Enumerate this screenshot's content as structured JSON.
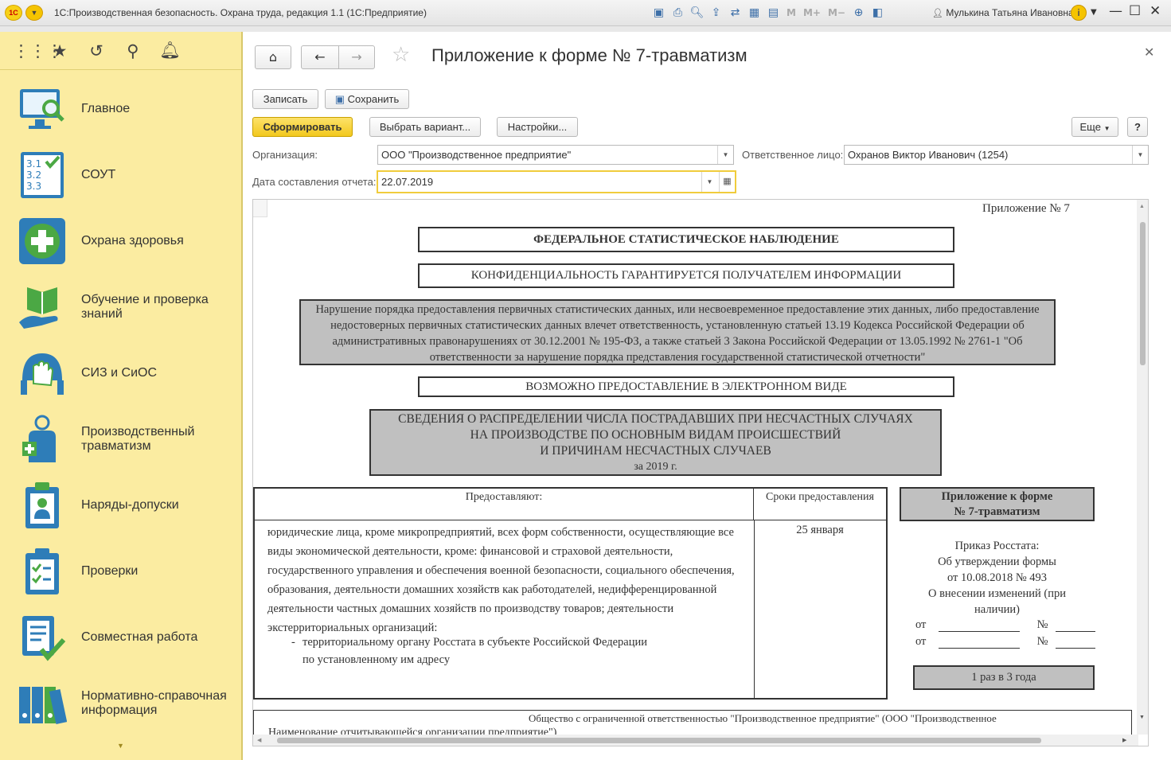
{
  "window": {
    "title": "1С:Производственная безопасность. Охрана труда, редакция 1.1  (1С:Предприятие)",
    "user": "Мулькина Татьяна Ивановна",
    "memory_buttons": [
      "M",
      "M+",
      "M−"
    ]
  },
  "sidebar": {
    "items": [
      {
        "label": "Главное",
        "icon": "monitor-search-icon"
      },
      {
        "label": "СОУТ",
        "icon": "checklist-icon"
      },
      {
        "label": "Охрана здоровья",
        "icon": "medical-cross-icon"
      },
      {
        "label": "Обучение и проверка знаний",
        "icon": "book-hand-icon"
      },
      {
        "label": "СИЗ и СиОС",
        "icon": "helmet-icon"
      },
      {
        "label": "Производственный травматизм",
        "icon": "injured-person-icon"
      },
      {
        "label": "Наряды-допуски",
        "icon": "permit-clipboard-icon"
      },
      {
        "label": "Проверки",
        "icon": "checklist-clipboard-icon"
      },
      {
        "label": "Совместная работа",
        "icon": "document-check-icon"
      },
      {
        "label": "Нормативно-справочная информация",
        "icon": "binders-icon"
      }
    ]
  },
  "form": {
    "title": "Приложение к форме № 7-травматизм",
    "buttons": {
      "write": "Записать",
      "save": "Сохранить",
      "generate": "Сформировать",
      "choose_variant": "Выбрать вариант...",
      "settings": "Настройки...",
      "more": "Еще",
      "help": "?"
    },
    "org_label": "Организация:",
    "org_value": "ООО \"Производственное предприятие\"",
    "responsible_label": "Ответственное лицо:",
    "responsible_value": "Охранов Виктор Иванович (1254)",
    "date_label": "Дата составления отчета:",
    "date_value": "22.07.2019"
  },
  "report": {
    "appendix": "Приложение № 7",
    "federal": "ФЕДЕРАЛЬНОЕ СТАТИСТИЧЕСКОЕ НАБЛЮДЕНИЕ",
    "confidential": "КОНФИДЕНЦИАЛЬНОСТЬ ГАРАНТИРУЕТСЯ ПОЛУЧАТЕЛЕМ ИНФОРМАЦИИ",
    "warning": "Нарушение порядка предоставления первичных статистических данных, или несвоевременное предоставление этих данных, либо предоставление недостоверных первичных статистических данных влечет ответственность, установленную статьей 13.19 Кодекса Российской Федерации об административных правонарушениях от 30.12.2001 № 195-ФЗ, а также статьей 3 Закона Российской Федерации от 13.05.1992 № 2761-1 \"Об ответственности за нарушение порядка представления государственной статистической отчетности\"",
    "electronic": "ВОЗМОЖНО ПРЕДОСТАВЛЕНИЕ В ЭЛЕКТРОННОМ ВИДЕ",
    "info_title_1": "СВЕДЕНИЯ О РАСПРЕДЕЛЕНИИ ЧИСЛА ПОСТРАДАВШИХ ПРИ НЕСЧАСТНЫХ СЛУЧАЯХ",
    "info_title_2": "НА ПРОИЗВОДСТВЕ ПО ОСНОВНЫМ ВИДАМ ПРОИСШЕСТВИЙ",
    "info_title_3": "И ПРИЧИНАМ НЕСЧАСТНЫХ СЛУЧАЕВ",
    "info_year": "за 2019 г.",
    "col_provide": "Предоставляют:",
    "col_deadline": "Сроки предоставления",
    "provide_text": "юридические лица, кроме микропредприятий, всех форм собственности, осуществляющие все виды экономической деятельности, кроме: финансовой и страховой деятельности, государственного управления и обеспечения военной безопасности, социального обеспечения, образования, деятельности домашних хозяйств как работодателей, недифференцированной деятельности частных домашних хозяйств по производству товаров; деятельности экстерриториальных организаций:",
    "provide_bullet_dash": "-",
    "provide_bullet_1": "территориальному органу Росстата в субъекте Российской Федерации",
    "provide_bullet_2": "по установленному им адресу",
    "deadline_value": "25 января",
    "form_box_1": "Приложение к форме",
    "form_box_2": "№ 7-травматизм",
    "order_1": "Приказ Росстата:",
    "order_2": "Об утверждении формы",
    "order_3": "от 10.08.2018 № 493",
    "order_4": "О внесении изменений (при",
    "order_5": "наличии)",
    "from_label": "от",
    "num_label": "№",
    "periodicity": "1 раз в 3 года",
    "org_full": "Общество с ограниченной ответственностью \"Производственное предприятие\" (ООО \"Производственное",
    "org_name_label": "Наименование отчитывающейся организации      предприятие\")"
  }
}
